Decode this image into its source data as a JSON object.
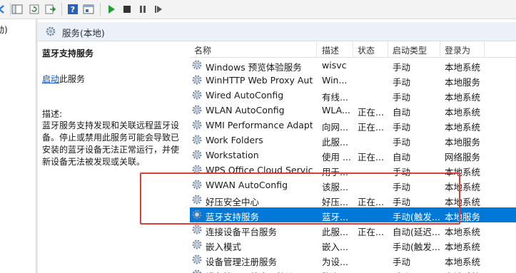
{
  "tree": {
    "partial_label": "动)"
  },
  "pane": {
    "title": "服务(本地)"
  },
  "detail": {
    "service_name": "蓝牙支持服务",
    "start_link": "启动",
    "start_suffix": "此服务",
    "description_label": "描述:",
    "description": "蓝牙服务支持发现和关联远程蓝牙设备。停止或禁用此服务可能会导致已安装的蓝牙设备无法正常运行，并使新设备无法被发现或关联。"
  },
  "columns": {
    "name": "名称",
    "description": "描述",
    "status": "状态",
    "startup": "启动类型",
    "logon": "登录为"
  },
  "rows": [
    {
      "name": "Windows 预览体验服务",
      "desc": "wisvc",
      "status": "",
      "startup": "手动",
      "logon": "本地系统"
    },
    {
      "name": "WinHTTP Web Proxy Aut...",
      "desc": "Win...",
      "status": "",
      "startup": "手动",
      "logon": "本地服务"
    },
    {
      "name": "Wired AutoConfig",
      "desc": "有线...",
      "status": "",
      "startup": "手动",
      "logon": "本地系统"
    },
    {
      "name": "WLAN AutoConfig",
      "desc": "WLA...",
      "status": "正在...",
      "startup": "自动",
      "logon": "本地系统"
    },
    {
      "name": "WMI Performance Adapt...",
      "desc": "向网...",
      "status": "正在...",
      "startup": "手动",
      "logon": "本地系统"
    },
    {
      "name": "Work Folders",
      "desc": "此服...",
      "status": "",
      "startup": "手动",
      "logon": "本地服务"
    },
    {
      "name": "Workstation",
      "desc": "使用 ...",
      "status": "正在...",
      "startup": "自动",
      "logon": "网络服务"
    },
    {
      "name": "WPS Office Cloud Service",
      "desc": "用于...",
      "status": "",
      "startup": "手动",
      "logon": "本地系统"
    },
    {
      "name": "WWAN AutoConfig",
      "desc": "该服...",
      "status": "",
      "startup": "手动",
      "logon": "本地系统"
    },
    {
      "name": "好压安全中心",
      "desc": "好压...",
      "status": "正在...",
      "startup": "手动",
      "logon": "本地系统"
    },
    {
      "name": "蓝牙支持服务",
      "desc": "蓝牙...",
      "status": "",
      "startup": "手动(触发...",
      "logon": "本地服务"
    },
    {
      "name": "连接设备平台服务",
      "desc": "此服...",
      "status": "正在...",
      "startup": "自动(延迟...",
      "logon": "本地系统"
    },
    {
      "name": "嵌入模式",
      "desc": "嵌入...",
      "status": "",
      "startup": "手动(触发...",
      "logon": "本地系统"
    },
    {
      "name": "设备管理注册服务",
      "desc": "为设...",
      "status": "",
      "startup": "手动",
      "logon": "本地系统"
    },
    {
      "name": "设备管理无线应用协议...",
      "desc": "路由...",
      "status": "",
      "startup": "手动",
      "logon": "本地系统"
    }
  ],
  "selected_row_index": 10,
  "colors": {
    "selection": "#0078d7",
    "highlight_box": "#d9403a",
    "link": "#0050c0"
  }
}
